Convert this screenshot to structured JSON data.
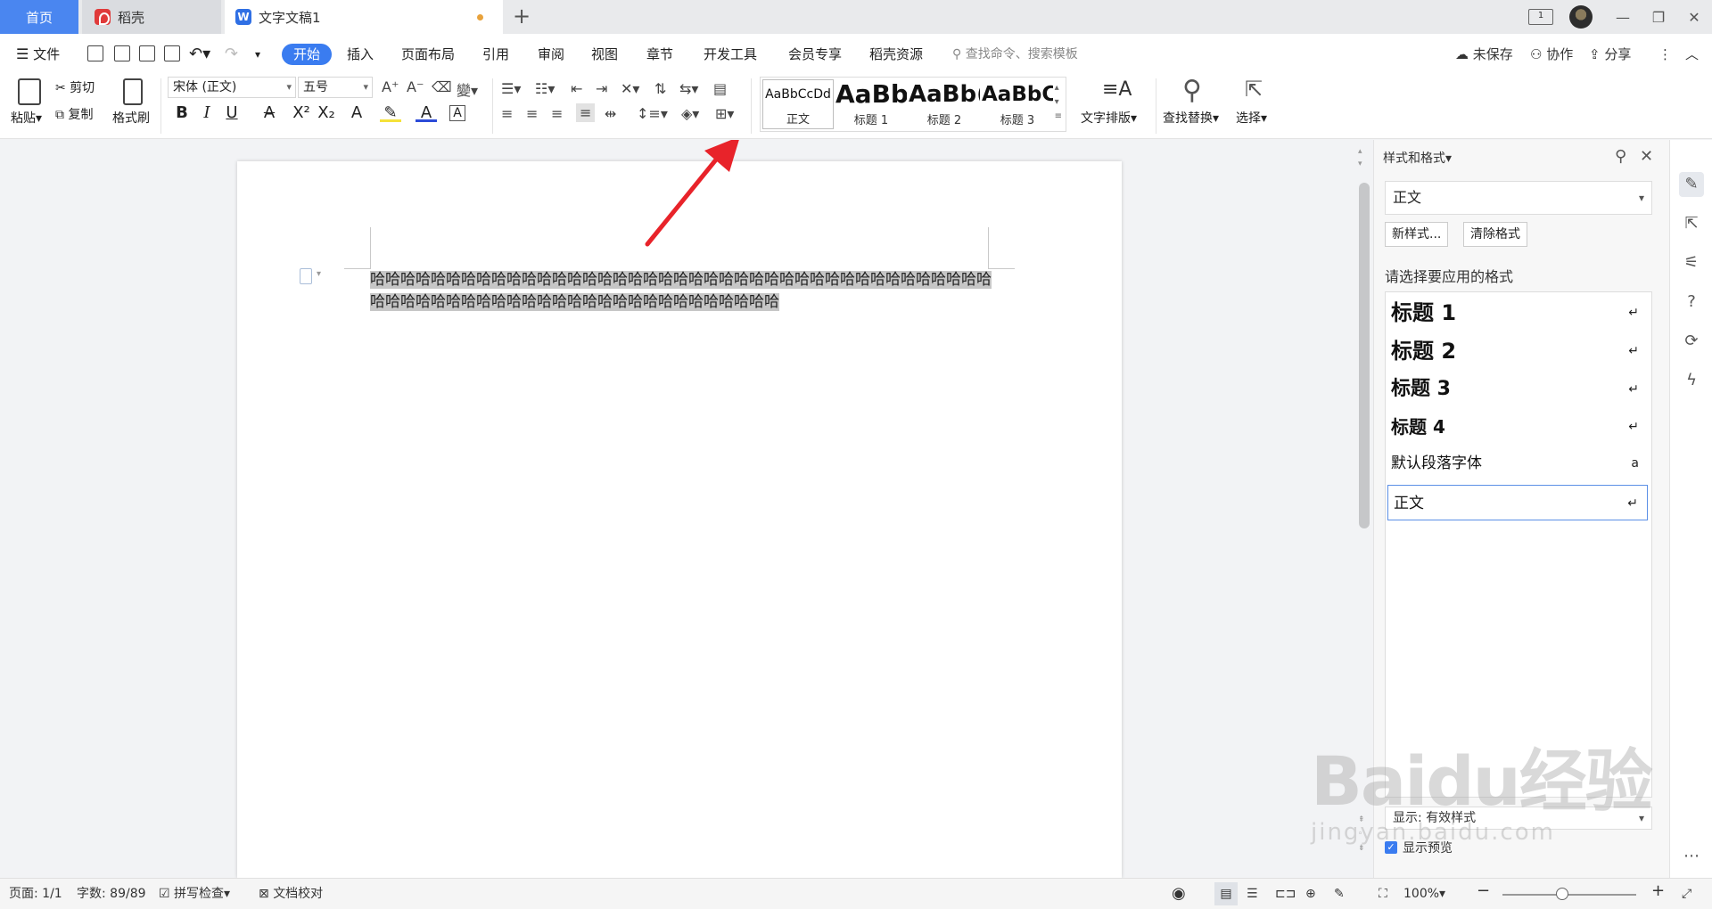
{
  "tabs": {
    "home": "首页",
    "daoke": "稻壳",
    "doc": "文字文稿1"
  },
  "menu": {
    "file": "文件",
    "items": [
      "开始",
      "插入",
      "页面布局",
      "引用",
      "审阅",
      "视图",
      "章节",
      "开发工具",
      "会员专享",
      "稻壳资源"
    ],
    "search_placeholder": "查找命令、搜索模板",
    "unsaved": "未保存",
    "collab": "协作",
    "share": "分享"
  },
  "ribbon": {
    "paste": "粘贴",
    "cut": "剪切",
    "copy": "复制",
    "format_painter": "格式刷",
    "font_name": "宋体 (正文)",
    "font_size": "五号",
    "styles": [
      {
        "preview": "AaBbCcDd",
        "name": "正文"
      },
      {
        "preview": "AaBb",
        "name": "标题 1"
      },
      {
        "preview": "AaBb(",
        "name": "标题 2"
      },
      {
        "preview": "AaBbC(",
        "name": "标题 3"
      }
    ],
    "text_layout": "文字排版",
    "find_replace": "查找替换",
    "select": "选择"
  },
  "document": {
    "text": "哈哈哈哈哈哈哈哈哈哈哈哈哈哈哈哈哈哈哈哈哈哈哈哈哈哈哈哈哈哈哈哈哈哈哈哈哈哈哈哈哈哈哈哈哈哈哈哈哈哈哈哈哈哈哈哈哈哈哈哈哈哈哈哈哈哈哈哈"
  },
  "pane": {
    "title": "样式和格式",
    "current_style": "正文",
    "new_style": "新样式...",
    "clear_format": "清除格式",
    "choose_label": "请选择要应用的格式",
    "styles": [
      {
        "label": "标题 1",
        "mark": "↵"
      },
      {
        "label": "标题 2",
        "mark": "↵"
      },
      {
        "label": "标题 3",
        "mark": "↵"
      },
      {
        "label": "标题 4",
        "mark": "↵"
      },
      {
        "label": "默认段落字体",
        "mark": "a"
      },
      {
        "label": "正文",
        "mark": "↵"
      }
    ],
    "show_label": "显示: 有效样式",
    "preview_label": "显示预览"
  },
  "status": {
    "page": "页面: 1/1",
    "word_count": "字数: 89/89",
    "spell_check": "拼写检查",
    "doc_proof": "文档校对",
    "zoom": "100%"
  },
  "watermark": {
    "brand": "Baidu经验",
    "url": "jingyan.baidu.com"
  },
  "colors": {
    "accent": "#3a7cf0",
    "home_tab": "#4a86f0",
    "arrow": "#e8232a",
    "selection": "#c6c6c6"
  }
}
